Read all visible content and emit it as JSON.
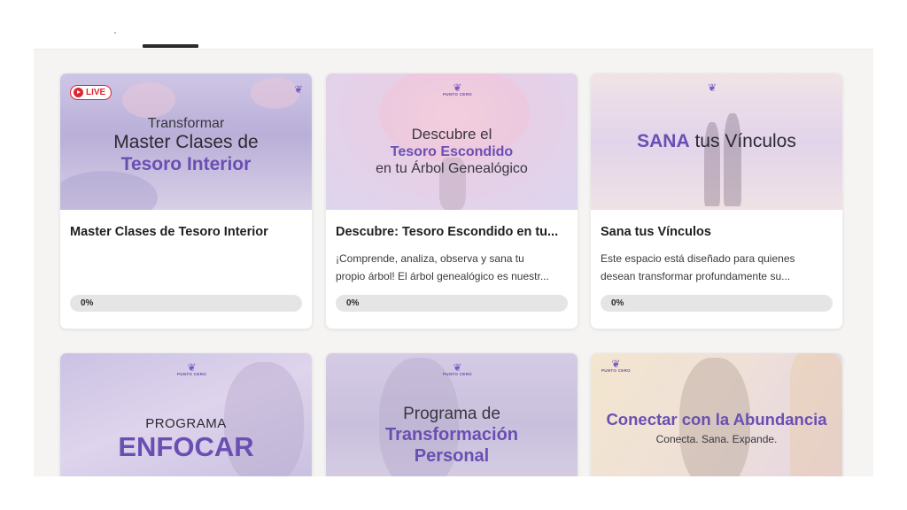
{
  "header": {
    "active_tab_indicator": true
  },
  "courses": [
    {
      "thumb_lines": [
        "Transformar",
        "Master Clases de",
        "Tesoro Interior"
      ],
      "live_label": "LIVE",
      "title": "Master Clases de Tesoro Interior",
      "description_lines": [],
      "progress": "0%"
    },
    {
      "thumb_lines": [
        "Descubre el",
        "Tesoro Escondido",
        "en tu Árbol Genealógico"
      ],
      "logo": "PUNTO CERO",
      "title": "Descubre: Tesoro Escondido en tu...",
      "description_lines": [
        "¡Comprende, analiza, observa y sana tu",
        "propio árbol! El árbol genealógico es nuestr..."
      ],
      "progress": "0%"
    },
    {
      "thumb_lines": [
        "SANA",
        "tus Vínculos"
      ],
      "logo": "PUNTO CERO",
      "title": "Sana tus Vínculos",
      "description_lines": [
        "Este espacio está diseñado para quienes",
        "desean transformar profundamente su..."
      ],
      "progress": "0%"
    },
    {
      "thumb_lines": [
        "PROGRAMA",
        "ENFOCAR"
      ],
      "logo": "PUNTO CERO"
    },
    {
      "thumb_lines": [
        "Programa de",
        "Transformación",
        "Personal"
      ],
      "logo": "PUNTO CERO"
    },
    {
      "thumb_lines": [
        "Conectar con la Abundancia",
        "Conecta. Sana. Expande."
      ],
      "logo": "PUNTO CERO"
    }
  ],
  "colors": {
    "accent_purple": "#6a4fb3",
    "live_red": "#e0242f",
    "progress_track": "#e5e5e5",
    "page_bg": "#f5f4f2"
  },
  "icons": {
    "live": "play-circle-icon",
    "logo": "butterfly-logo-icon"
  }
}
